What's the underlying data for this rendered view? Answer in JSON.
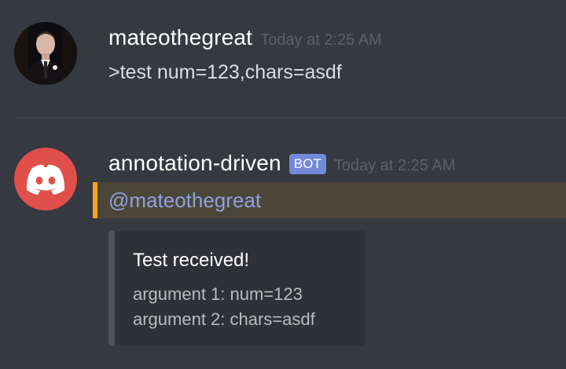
{
  "messages": [
    {
      "username": "mateothegreat",
      "timestamp": "Today at 2:25 AM",
      "content": ">test num=123,chars=asdf",
      "avatar": "user-photo-avatar"
    },
    {
      "username": "annotation-driven",
      "bot_tag": "BOT",
      "timestamp": "Today at 2:25 AM",
      "mention": "@mateothegreat",
      "avatar": "discord-logo-icon",
      "embed": {
        "title": "Test received!",
        "lines": [
          "argument 1: num=123",
          "argument 2: chars=asdf"
        ]
      }
    }
  ],
  "colors": {
    "background": "#36393f",
    "mention_highlight": "#4b4638",
    "mention_bar": "#faa61a",
    "mention_text": "#8ea1e1",
    "bot_tag": "#7289da",
    "discord_avatar": "#e14f4a",
    "embed_bg": "#2f3136",
    "embed_border": "#4f545c"
  }
}
